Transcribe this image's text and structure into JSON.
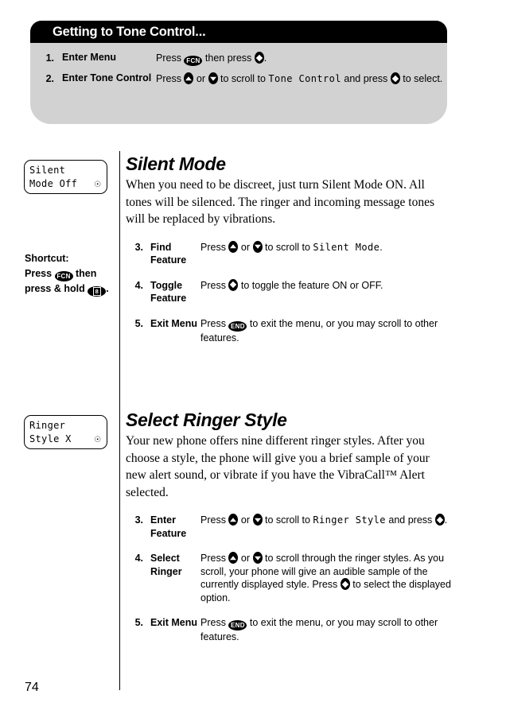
{
  "callout": {
    "title": "Getting to Tone Control...",
    "steps": [
      {
        "num": "1.",
        "label": "Enter Menu",
        "desc_parts": [
          "Press ",
          "FCN",
          " then press ",
          "SELECT",
          "."
        ]
      },
      {
        "num": "2.",
        "label": "Enter Tone Control",
        "desc_parts": [
          "Press ",
          "UP",
          " or ",
          "DOWN",
          " to scroll to ",
          "Tone Control",
          " and press ",
          "SELECT",
          " to select."
        ]
      }
    ]
  },
  "silent": {
    "lcd": {
      "line1": "Silent",
      "line2": "Mode Off",
      "icon": "bell-icon"
    },
    "shortcut": {
      "heading": "Shortcut:",
      "parts": [
        "Press ",
        "FCN",
        " then press & hold ",
        "8",
        "."
      ]
    },
    "title": "Silent Mode",
    "intro": "When you need to be discreet, just turn Silent Mode ON. All tones will be silenced. The ringer and incoming message tones will be replaced by vibrations.",
    "steps": [
      {
        "num": "3.",
        "label": "Find Feature",
        "desc_parts": [
          "Press ",
          "UP",
          " or ",
          "DOWN",
          " to scroll to ",
          "Silent Mode",
          "."
        ]
      },
      {
        "num": "4.",
        "label": "Toggle Feature",
        "desc_parts": [
          "Press ",
          "SELECT",
          " to toggle the feature ON or OFF."
        ]
      },
      {
        "num": "5.",
        "label": "Exit Menu",
        "desc_parts": [
          "Press ",
          "END",
          " to exit the menu, or you may scroll to other features."
        ]
      }
    ]
  },
  "ringer": {
    "lcd": {
      "line1": "Ringer",
      "line2": "Style X",
      "icon": "bell-icon"
    },
    "title": "Select Ringer Style",
    "intro": "Your new phone offers nine different ringer styles. After you choose a style, the phone will give you a brief sample of your new alert sound, or vibrate if you have the VibraCall™ Alert selected.",
    "steps": [
      {
        "num": "3.",
        "label": "Enter Feature",
        "desc_parts": [
          "Press ",
          "UP",
          " or ",
          "DOWN",
          " to scroll to ",
          "Ringer Style",
          " and press ",
          "SELECT",
          "."
        ]
      },
      {
        "num": "4.",
        "label": "Select Ringer",
        "desc_parts": [
          "Press ",
          "UP",
          " or ",
          "DOWN",
          " to scroll through the ringer styles. As you scroll, your phone will give an audible sample of the currently displayed style. Press ",
          "SELECT",
          " to select the displayed option."
        ]
      },
      {
        "num": "5.",
        "label": "Exit Menu",
        "desc_parts": [
          "Press ",
          "END",
          " to exit the menu, or you may scroll to other features."
        ]
      }
    ]
  },
  "keys": {
    "fcn": "FCN",
    "end": "END",
    "eight": "8"
  },
  "page_number": "74",
  "colors": {
    "header_bg": "#000000",
    "callout_bg": "#d2d2d2",
    "text": "#000000"
  }
}
